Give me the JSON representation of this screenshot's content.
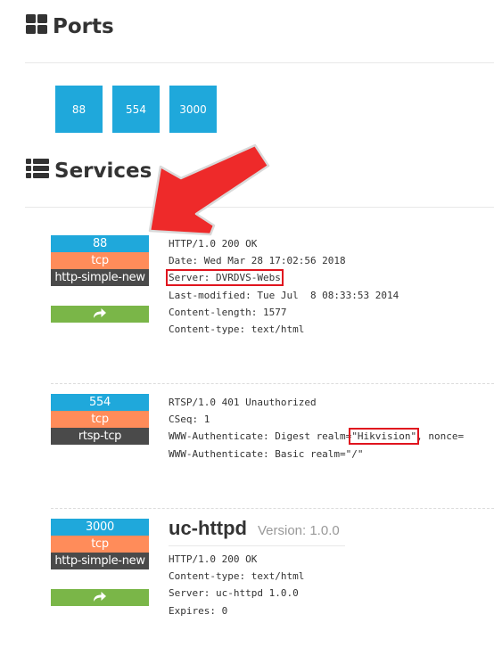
{
  "ports_section": {
    "title": "Ports",
    "icon": "th-large-icon",
    "ports": [
      "88",
      "554",
      "3000"
    ]
  },
  "services_section": {
    "title": "Services",
    "icon": "th-list-icon",
    "services": [
      {
        "port": "88",
        "protocol": "tcp",
        "name": "http-simple-new",
        "has_link": true,
        "link_icon": "share-arrow-icon",
        "banner": {
          "line1": "HTTP/1.0 200 OK",
          "line2": "Date: Wed Mar 28 17:02:56 2018",
          "line3": "Server: DVRDVS-Webs",
          "line4": "Last-modified: Tue Jul  8 08:33:53 2014",
          "line5": "Content-length: 1577",
          "line6": "Content-type: text/html"
        }
      },
      {
        "port": "554",
        "protocol": "tcp",
        "name": "rtsp-tcp",
        "has_link": false,
        "banner": {
          "line1": "RTSP/1.0 401 Unauthorized",
          "line2": "CSeq: 1",
          "line3_prefix": "WWW-Authenticate: Digest realm=",
          "line3_highlight": "\"Hikvision\"",
          "line3_suffix": ", nonce=",
          "line4": "WWW-Authenticate: Basic realm=\"/\""
        }
      },
      {
        "port": "3000",
        "protocol": "tcp",
        "name": "http-simple-new",
        "has_link": true,
        "link_icon": "share-arrow-icon",
        "product": "uc-httpd",
        "version_label": "Version: 1.0.0",
        "banner": {
          "line1": "HTTP/1.0 200 OK",
          "line2": "Content-type: text/html",
          "line3": "Server: uc-httpd 1.0.0",
          "line4": "Expires: 0"
        }
      }
    ]
  },
  "annotation": {
    "type": "arrow",
    "color": "#ee2a2a",
    "points_to": "service-88"
  }
}
